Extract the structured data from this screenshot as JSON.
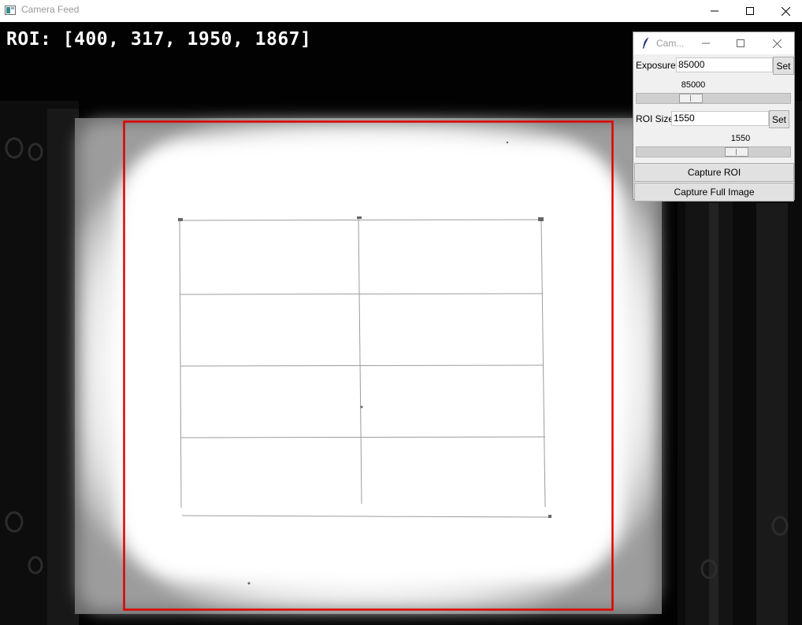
{
  "main_window": {
    "title": "Camera Feed"
  },
  "feed": {
    "roi_label": "ROI: [400, 317, 1950, 1867]",
    "roi_box_color": "#e00000"
  },
  "tool_window": {
    "title": "Cam...",
    "exposure": {
      "label": "Exposure",
      "value": "85000",
      "set_label": "Set",
      "scale_value": "85000",
      "scale_fraction": 0.33
    },
    "roi_size": {
      "label": "ROI Size",
      "value": "1550",
      "set_label": "Set",
      "scale_value": "1550",
      "scale_fraction": 0.68
    },
    "capture_roi_label": "Capture ROI",
    "capture_full_label": "Capture Full Image"
  },
  "icons": [
    "app-icon",
    "minimize-icon",
    "maximize-icon",
    "close-icon",
    "feather-icon"
  ]
}
